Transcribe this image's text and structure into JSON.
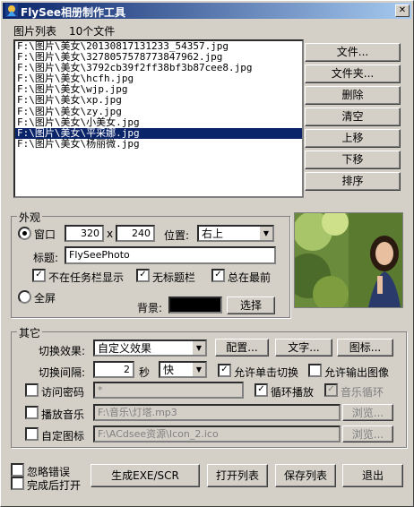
{
  "title": "FlySee相册制作工具",
  "list_header": {
    "label": "图片列表",
    "count": "10个文件"
  },
  "files": [
    "F:\\图片\\美女\\20130817131233_54357.jpg",
    "F:\\图片\\美女\\3278057578773847962.jpg",
    "F:\\图片\\美女\\3792cb39f2ff38bf3b87cee8.jpg",
    "F:\\图片\\美女\\hcfh.jpg",
    "F:\\图片\\美女\\wjp.jpg",
    "F:\\图片\\美女\\xp.jpg",
    "F:\\图片\\美女\\zy.jpg",
    "F:\\图片\\美女\\小美女.jpg",
    "F:\\图片\\美女\\平采娜.jpg",
    "F:\\图片\\美女\\杨丽微.jpg"
  ],
  "selected_index": 8,
  "list_buttons": [
    "文件...",
    "文件夹...",
    "删除",
    "清空",
    "上移",
    "下移",
    "排序"
  ],
  "appearance": {
    "group_title": "外观",
    "window_label": "窗口",
    "width": "320",
    "x_label": "x",
    "height": "240",
    "position_label": "位置:",
    "position_value": "右上",
    "caption_label": "标题:",
    "caption_value": "FlySeePhoto",
    "opt_no_taskbar": "不在任务栏显示",
    "opt_no_titlebar": "无标题栏",
    "opt_topmost": "总在最前",
    "fullscreen_label": "全屏",
    "background_label": "背景:",
    "background_color": "#000000",
    "choose_button": "选择"
  },
  "other": {
    "group_title": "其它",
    "switch_effect_label": "切换效果:",
    "switch_effect_value": "自定义效果",
    "config_button": "配置...",
    "text_button": "文字...",
    "icon_button": "图标...",
    "interval_label": "切换间隔:",
    "interval_value": "2",
    "seconds_label": "秒",
    "speed_value": "快",
    "allow_click_switch": "允许单击切换",
    "allow_output_image": "允许输出图像",
    "password_label": "访问密码",
    "password_value": "*",
    "loop_play": "循环播放",
    "music_loop": "音乐循环",
    "play_music_label": "播放音乐",
    "music_path": "F:\\音乐\\灯塔.mp3",
    "browse_music": "浏览...",
    "custom_icon_label": "自定图标",
    "icon_path": "F:\\ACdsee资源\\Icon_2.ico",
    "browse_icon": "浏览..."
  },
  "footer": {
    "ignore_errors": "忽略错误",
    "open_after": "完成后打开",
    "generate_button": "生成EXE/SCR",
    "open_list_button": "打开列表",
    "save_list_button": "保存列表",
    "exit_button": "退出"
  }
}
